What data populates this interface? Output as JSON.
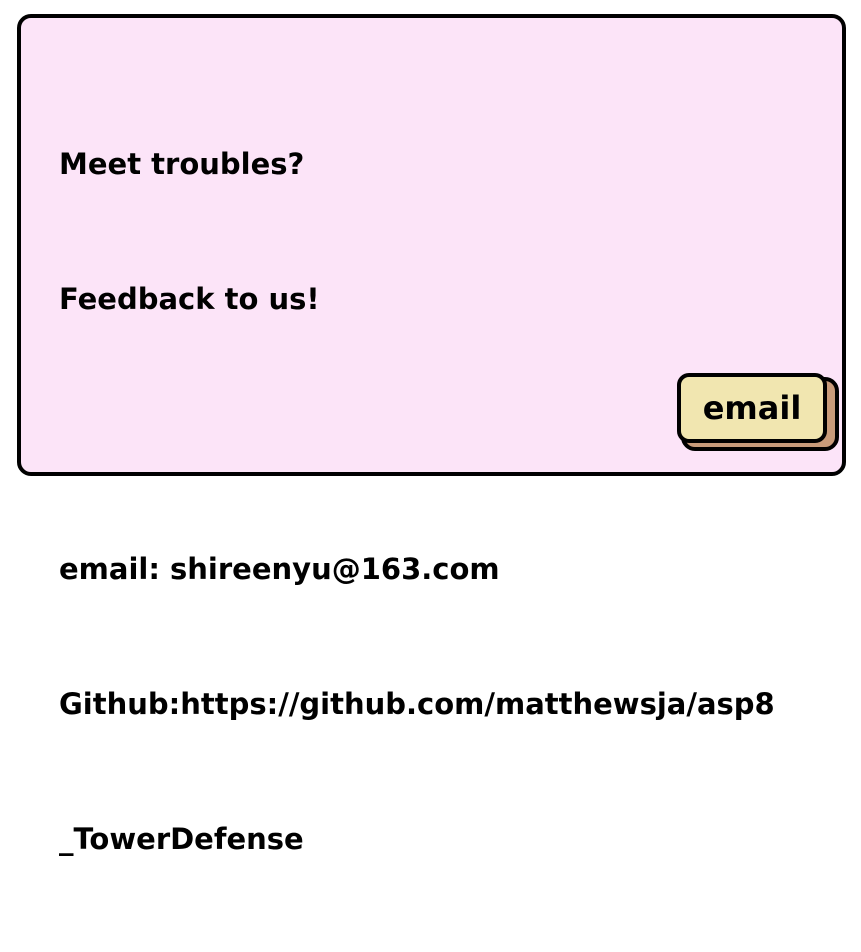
{
  "dialog": {
    "lines": [
      "Meet troubles?",
      "Feedback to us!",
      "",
      "email: shireenyu@163.com",
      "Github:https://github.com/matthewsja/asp8",
      "_TowerDefense"
    ],
    "email_button_label": "email"
  },
  "colors": {
    "panel_background": "#fce4f8",
    "border": "#000000",
    "button_background": "#f1e6b0",
    "button_shadow": "#c89b7a"
  }
}
